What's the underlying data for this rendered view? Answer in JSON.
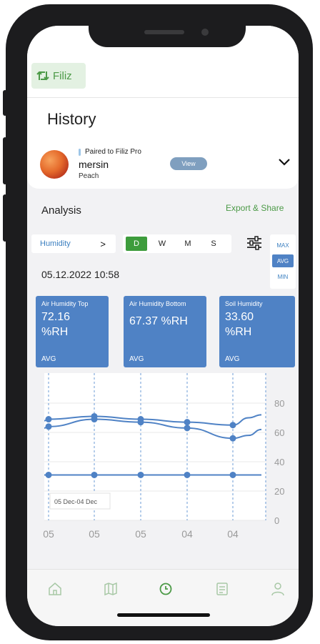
{
  "header": {
    "brand": "Filiz",
    "page_title": "History"
  },
  "device": {
    "paired_label": "Paired to Filiz Pro",
    "plant_name": "mersin",
    "plant_type": "Peach",
    "view_label": "View"
  },
  "analysis": {
    "title": "Analysis",
    "export_label": "Export & Share",
    "metric": "Humidity",
    "ranges": [
      "D",
      "W",
      "M",
      "S"
    ],
    "active_range": "D",
    "aggregates": [
      "MAX",
      "AVG",
      "MIN"
    ],
    "active_aggregate": "AVG",
    "datetime": "05.12.2022 10:58"
  },
  "cards": [
    {
      "label": "Air Humidity Top",
      "value": "72.16",
      "unit": "%RH",
      "agg": "AVG"
    },
    {
      "label": "Air Humidity Bottom",
      "value": "67.37",
      "unit": "%RH",
      "agg": "AVG"
    },
    {
      "label": "Soil Humidity",
      "value": "33.60",
      "unit": "%RH",
      "agg": "AVG"
    }
  ],
  "chart_data": {
    "type": "line",
    "x": [
      "05",
      "05",
      "05",
      "04",
      "04"
    ],
    "ylim": [
      0,
      80
    ],
    "yticks": [
      0,
      20,
      40,
      60,
      80
    ],
    "range_label": "05 Dec-04 Dec",
    "grid": true,
    "series": [
      {
        "values": [
          69,
          71,
          69,
          67,
          65
        ],
        "color": "#4f82c5"
      },
      {
        "values": [
          64,
          69,
          67,
          63,
          56
        ],
        "color": "#4f82c5"
      },
      {
        "values": [
          31,
          31,
          31,
          31,
          31
        ],
        "color": "#4f82c5"
      }
    ]
  },
  "nav": {
    "items": [
      "home-icon",
      "map-icon",
      "clock-icon",
      "notes-icon",
      "user-icon"
    ],
    "active": "clock-icon",
    "active_color": "#4c9a47",
    "inactive_color": "#a8c8a6"
  }
}
